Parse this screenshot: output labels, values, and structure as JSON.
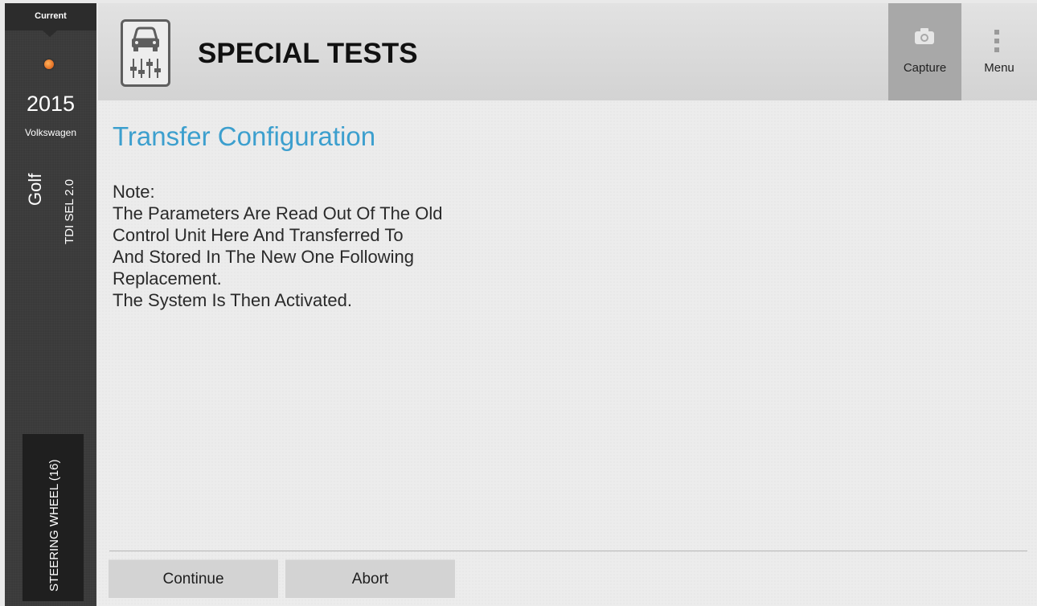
{
  "sidebar": {
    "current_label": "Current",
    "year": "2015",
    "make": "Volkswagen",
    "model": "Golf",
    "trim": "TDI SEL 2.0",
    "module": "STEERING WHEEL (16)",
    "status_color": "#e8762a"
  },
  "header": {
    "title": "SPECIAL TESTS",
    "icon": "car-test-icon",
    "capture_label": "Capture",
    "menu_label": "Menu"
  },
  "content": {
    "heading": "Transfer Configuration",
    "note_lines": [
      "Note:",
      "The Parameters Are Read Out Of The Old",
      "Control Unit Here And Transferred To",
      "And Stored In The New One Following",
      "Replacement.",
      "The System Is Then Activated."
    ]
  },
  "actions": {
    "continue_label": "Continue",
    "abort_label": "Abort"
  },
  "colors": {
    "accent": "#3c9fce",
    "sidebar_bg": "#3a3a3a"
  }
}
